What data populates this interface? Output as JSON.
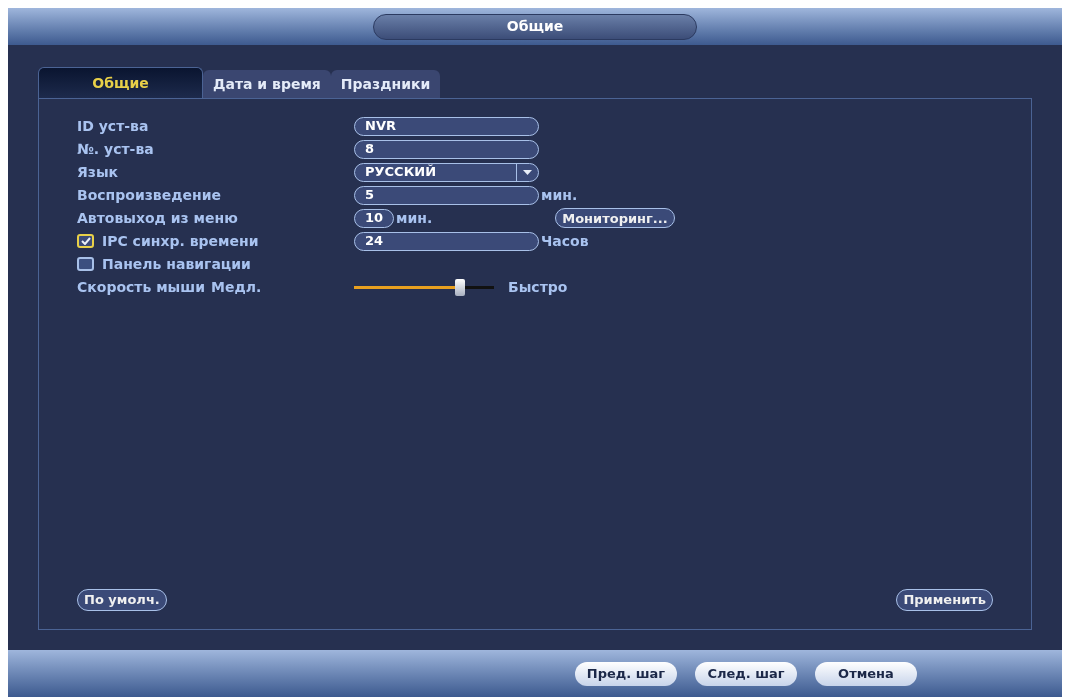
{
  "window": {
    "title": "Общие"
  },
  "tabs": [
    {
      "label": "Общие",
      "selected": true
    },
    {
      "label": "Дата и время",
      "selected": false
    },
    {
      "label": "Праздники",
      "selected": false
    }
  ],
  "form": {
    "rows": [
      {
        "kind": "text",
        "label": "ID уст-ва",
        "value": "NVR"
      },
      {
        "kind": "text",
        "label": "№. уст-ва",
        "value": "8"
      },
      {
        "kind": "select",
        "label": "Язык",
        "value": "РУССКИЙ"
      },
      {
        "kind": "text",
        "label": "Воспроизведение",
        "value": "5",
        "unit": "мин."
      },
      {
        "kind": "short",
        "label": "Автовыход из меню",
        "value": "10",
        "unit": "мин.",
        "button": "Мониторинг..."
      },
      {
        "kind": "checkbox",
        "label": "IPC синхр. времени",
        "checked": true,
        "value": "24",
        "unit": "Часов"
      },
      {
        "kind": "checkbox",
        "label": "Панель навигации",
        "checked": false
      },
      {
        "kind": "slider",
        "label": "Скорость мыши",
        "min_label": "Медл.",
        "max_label": "Быстро",
        "level": 0.76
      }
    ]
  },
  "panel_buttons": [
    "По умолч.",
    "Применить"
  ],
  "footer_buttons": [
    "Пред. шаг",
    "След. шаг",
    "Отмена"
  ]
}
